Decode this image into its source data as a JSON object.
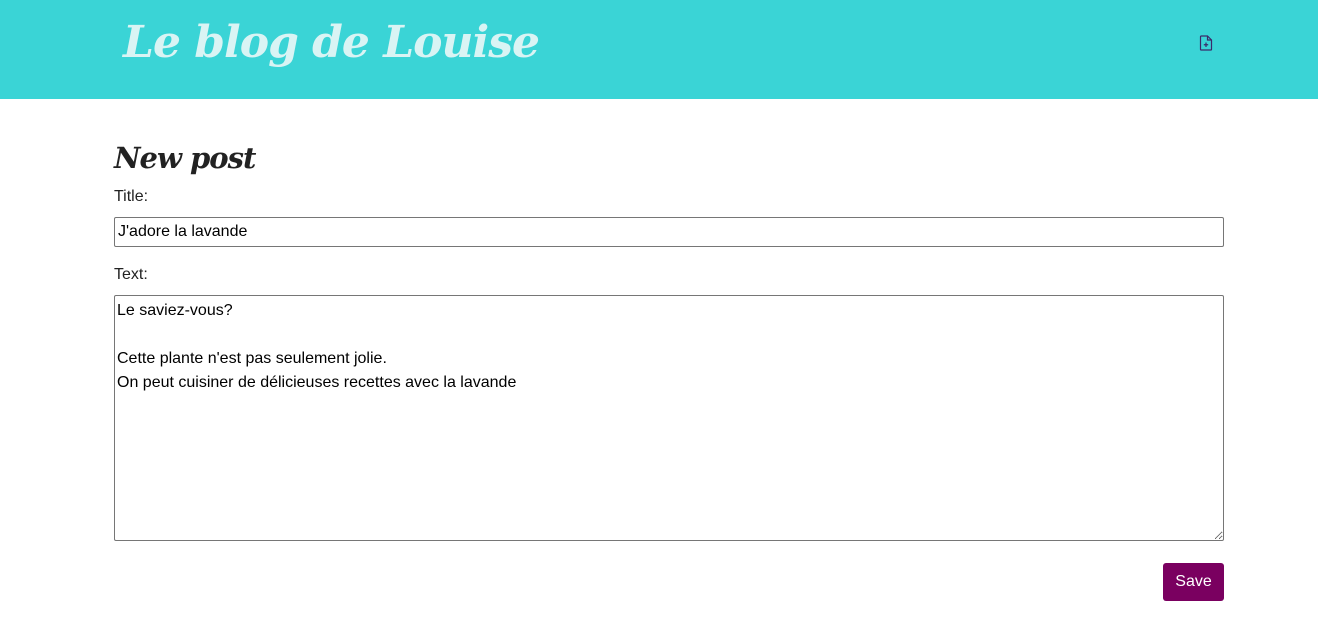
{
  "header": {
    "site_title": "Le blog de Louise",
    "new_post_icon": "file-plus-icon",
    "background_color": "#3ad4d6"
  },
  "main": {
    "page_heading": "New post",
    "title_label": "Title:",
    "title_value": "J'adore la lavande",
    "text_label": "Text:",
    "text_value": "Le saviez-vous?\n\nCette plante n'est pas seulement jolie.\nOn peut cuisiner de délicieuses recettes avec la lavande",
    "save_label": "Save",
    "save_color": "#7a0060"
  }
}
